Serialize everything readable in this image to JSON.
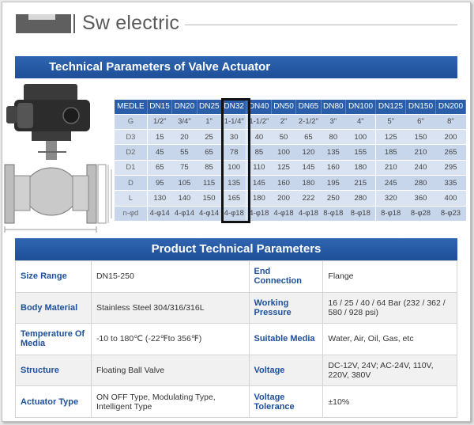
{
  "header": {
    "title": "Sw electric"
  },
  "section1": {
    "title": "Technical Parameters of Valve Actuator"
  },
  "dims_table": {
    "headers": [
      "MEDLE",
      "DN15",
      "DN20",
      "DN25",
      "DN32",
      "DN40",
      "DN50",
      "DN65",
      "DN80",
      "DN100",
      "DN125",
      "DN150",
      "DN200"
    ],
    "rows": [
      [
        "G",
        "1/2\"",
        "3/4\"",
        "1\"",
        "1-1/4\"",
        "1-1/2\"",
        "2\"",
        "2-1/2\"",
        "3\"",
        "4\"",
        "5\"",
        "6\"",
        "8\""
      ],
      [
        "D3",
        "15",
        "20",
        "25",
        "30",
        "40",
        "50",
        "65",
        "80",
        "100",
        "125",
        "150",
        "200"
      ],
      [
        "D2",
        "45",
        "55",
        "65",
        "78",
        "85",
        "100",
        "120",
        "135",
        "155",
        "185",
        "210",
        "265"
      ],
      [
        "D1",
        "65",
        "75",
        "85",
        "100",
        "110",
        "125",
        "145",
        "160",
        "180",
        "210",
        "240",
        "295"
      ],
      [
        "D",
        "95",
        "105",
        "115",
        "135",
        "145",
        "160",
        "180",
        "195",
        "215",
        "245",
        "280",
        "335"
      ],
      [
        "L",
        "130",
        "140",
        "150",
        "165",
        "180",
        "200",
        "222",
        "250",
        "280",
        "320",
        "360",
        "400"
      ],
      [
        "n-φd",
        "4-φ14",
        "4-φ14",
        "4-φ14",
        "4-φ18",
        "4-φ18",
        "4-φ18",
        "4-φ18",
        "8-φ18",
        "8-φ18",
        "8-φ18",
        "8-φ28",
        "8-φ23"
      ]
    ]
  },
  "section2": {
    "title": "Product Technical Parameters"
  },
  "specs": [
    {
      "k1": "Size Range",
      "v1": "DN15-250",
      "k2": "End Connection",
      "v2": "Flange"
    },
    {
      "k1": "Body Material",
      "v1": "Stainless Steel 304/316/316L",
      "k2": "Working Pressure",
      "v2": "16 / 25 / 40 / 64 Bar (232 / 362 / 580 / 928 psi)"
    },
    {
      "k1": "Temperature Of Media",
      "v1": "-10 to 180℃ (-22℉to 356℉)",
      "k2": "Suitable Media",
      "v2": "Water, Air, Oil, Gas, etc"
    },
    {
      "k1": "Structure",
      "v1": "Floating Ball Valve",
      "k2": "Voltage",
      "v2": "DC-12V, 24V; AC-24V, 110V, 220V, 380V"
    },
    {
      "k1": "Actuator Type",
      "v1": "ON OFF Type, Modulating Type, Intelligent Type",
      "k2": "Voltage Tolerance",
      "v2": "±10%"
    }
  ],
  "colors": {
    "brand_blue": "#2a5ea9",
    "label_blue": "#1d4f9b",
    "highlight": "#111111"
  }
}
